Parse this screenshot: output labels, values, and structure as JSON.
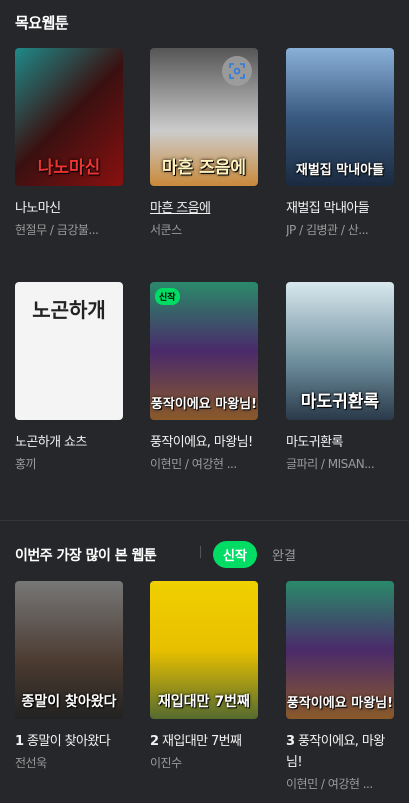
{
  "section1": {
    "title": "목요웹툰",
    "items": [
      {
        "title": "나노마신",
        "author": "현절무 / 금강불...",
        "logo": "나노마신"
      },
      {
        "title": "마흔 즈음에",
        "author": "서쿤스",
        "logo": "마흔 즈음에"
      },
      {
        "title": "재벌집 막내아들",
        "author": "JP / 김병관 / 산...",
        "logo": "재벌집 막내아들"
      },
      {
        "title": "노곤하개 쇼츠",
        "author": "홍끼",
        "logo": "노곤하개"
      },
      {
        "title": "풍작이에요, 마왕님!",
        "author": "이현민 / 여강현 ...",
        "logo": "풍작이에요 마왕님!",
        "badge": "신작"
      },
      {
        "title": "마도귀환록",
        "author": "글파리 / MISAN...",
        "logo": "마도귀환록"
      }
    ]
  },
  "section2": {
    "title": "이번주 가장 많이 본 웹툰",
    "tabs": [
      "신작",
      "완결"
    ],
    "items": [
      {
        "rank": "1",
        "title": "종말이 찾아왔다",
        "author": "전선욱",
        "logo": "종말이 찾아왔다"
      },
      {
        "rank": "2",
        "title": "재입대만 7번째",
        "author": "이진수",
        "logo": "재입대만 7번째"
      },
      {
        "rank": "3",
        "title": "풍작이에요, 마왕님!",
        "author": "이현민 / 여강현 ...",
        "logo": "풍작이에요 마왕님!"
      }
    ]
  }
}
